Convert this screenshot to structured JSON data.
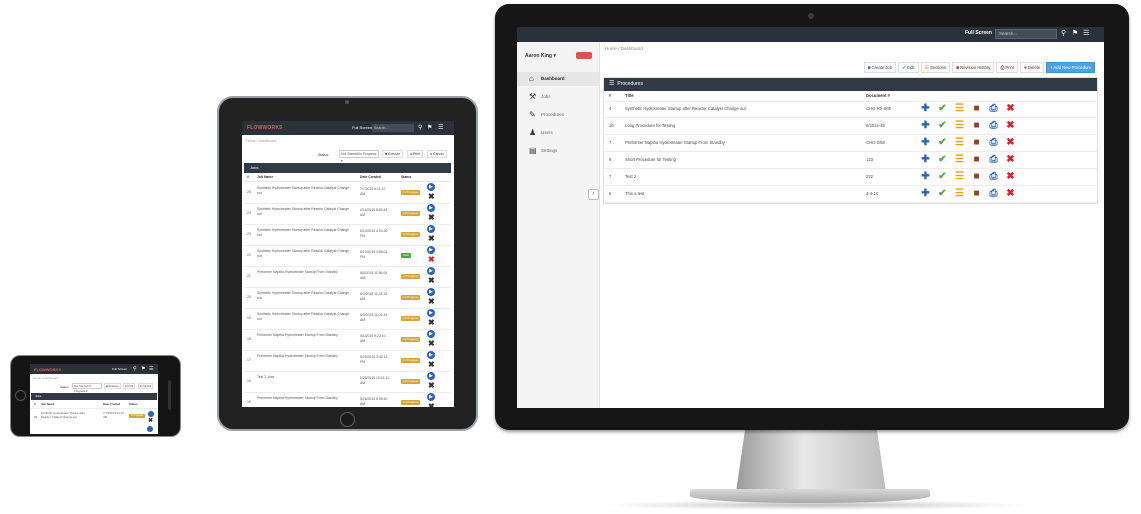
{
  "desktop": {
    "topbar": {
      "full_screen_label": "Full Screen",
      "search_placeholder": "Search...",
      "search_icon": "search-icon",
      "flag_icon": "flag-icon",
      "menu_icon": "menu-icon"
    },
    "sidebar": {
      "user_label": "Aaron King ▾",
      "items": [
        {
          "label": "Dashboard",
          "icon": "home-icon",
          "glyph": "⌂"
        },
        {
          "label": "Jobs",
          "icon": "wrench-icon",
          "glyph": "⚒"
        },
        {
          "label": "Procedures",
          "icon": "edit-icon",
          "glyph": "✎"
        },
        {
          "label": "Users",
          "icon": "user-icon",
          "glyph": "♟"
        },
        {
          "label": "Settings",
          "icon": "settings-icon",
          "glyph": "▤"
        }
      ],
      "collapse_glyph": "‹"
    },
    "breadcrumb": "Home  /  Dashboard",
    "toolbar": [
      {
        "label": "Create Job",
        "glyph": "■",
        "color": "#2a63b8"
      },
      {
        "label": "Edit",
        "glyph": "✔",
        "color": "#52a34a"
      },
      {
        "label": "Sections",
        "glyph": "☰",
        "color": "#f0a000"
      },
      {
        "label": "Revision History",
        "glyph": "■",
        "color": "#9b3b2a"
      },
      {
        "label": "Print",
        "glyph": "⎙",
        "color": "#333333"
      },
      {
        "label": "Delete",
        "glyph": "●",
        "color": "#d9232a"
      },
      {
        "label": "+ Add New Procedure",
        "glyph": "",
        "color": "#ffffff"
      }
    ],
    "panel_title": "Procedures",
    "columns": {
      "num": "#",
      "title": "Title",
      "doc": "Document #"
    },
    "rows": [
      {
        "num": "4",
        "title": "Synthetic Hydrotreater Startup after Reactor Catalyst Change out",
        "doc": "CHO-RX-005"
      },
      {
        "num": "10",
        "title": "Long Procedure for Testing",
        "doc": "9/2012-45"
      },
      {
        "num": "7",
        "title": "Preformer Naptha Hydrotreater Startup From Standby",
        "doc": "CHO-SN8"
      },
      {
        "num": "9",
        "title": "Short Procedure for Testing",
        "doc": "123"
      },
      {
        "num": "7",
        "title": "Test 2",
        "doc": "222"
      },
      {
        "num": "6",
        "title": "This a test",
        "doc": "4-4-14"
      }
    ],
    "row_actions": [
      {
        "icon": "add-icon",
        "glyph": "✚",
        "color": "#2a63b8"
      },
      {
        "icon": "check-icon",
        "glyph": "✔",
        "color": "#52a34a"
      },
      {
        "icon": "list-icon",
        "glyph": "☰",
        "color": "#f0a000"
      },
      {
        "icon": "folder-icon",
        "glyph": "■",
        "color": "#9b3b2a"
      },
      {
        "icon": "print-icon",
        "glyph": "⎙",
        "color": "#2a63b8"
      },
      {
        "icon": "delete-icon",
        "glyph": "✖",
        "color": "#d9232a"
      }
    ]
  },
  "tablet": {
    "logo": "FLOWWORKS",
    "full_screen_label": "Full Screen",
    "search_placeholder": "Search...",
    "breadcrumb": "Home  /  Dashboard",
    "status_label": "Status:",
    "status_select": "Not Started/In Progress ▾",
    "buttons": [
      "■ Execute",
      "● Print",
      "● Cancel"
    ],
    "panel_title": "Jobs",
    "columns": {
      "num": "#",
      "job": "Job Name",
      "date": "Date Created",
      "status": "Status"
    },
    "rows": [
      {
        "num": "25",
        "job": "Synthetic Hydrotreater Startup after Reactor Catalyst Change out",
        "date": "7/7/2015 9:11:10 AM",
        "status": "In Progress",
        "green": false
      },
      {
        "num": "24",
        "job": "Synthetic Hydrotreater Startup after Reactor Catalyst Change out",
        "date": "6/15/2015 8:59:44 AM",
        "status": "In Progress",
        "green": false
      },
      {
        "num": "23",
        "job": "Synthetic Hydrotreater Startup after Reactor Catalyst Change out",
        "date": "6/10/2015 4:04:30 PM",
        "status": "In Progress",
        "green": false
      },
      {
        "num": "22",
        "job": "Synthetic Hydrotreater Startup after Reactor Catalyst Change out",
        "date": "6/10/2015 3:58:01 PM",
        "status": "New",
        "green": true
      },
      {
        "num": "21",
        "job": "Preformer Naptha Hydrotreater Startup From Standby",
        "date": "6/5/2015 11:56:05 AM",
        "status": "In Progress",
        "green": false
      },
      {
        "num": "20",
        "job": "Synthetic Hydrotreater Startup after Reactor Catalyst Change out",
        "date": "6/3/2015 11:24:15 AM",
        "status": "In Progress",
        "green": false
      },
      {
        "num": "19",
        "job": "Synthetic Hydrotreater Startup after Reactor Catalyst Change out",
        "date": "6/3/2015 11:01:33 AM",
        "status": "In Progress",
        "green": false
      },
      {
        "num": "18",
        "job": "Preformer Naptha Hydrotreater Startup From Standby",
        "date": "6/1/2015 9:22:10 AM",
        "status": "In Progress",
        "green": false
      },
      {
        "num": "17",
        "job": "Preformer Naptha Hydrotreater Startup From Standby",
        "date": "5/29/2015 3:40:12 PM",
        "status": "In Progress",
        "green": false
      },
      {
        "num": "16",
        "job": "Test 2 Jobs",
        "date": "5/28/2015 10:41:11 AM",
        "status": "In Progress",
        "green": false
      },
      {
        "num": "15",
        "job": "Preformer Naptha Hydrotreater Startup From Standby",
        "date": "5/26/2015 8:05:40 AM",
        "status": "In Progress",
        "green": false
      }
    ]
  },
  "phone": {
    "logo": "FLOWWORKS",
    "full_screen_label": "Full Screen",
    "breadcrumb": "Home  /  Dashboard",
    "status_label": "Status:",
    "status_select": "Not Started/In Progress ▾",
    "buttons": [
      "■ Execute",
      "● Print",
      "● Cancel"
    ],
    "panel_title": "Jobs",
    "columns": {
      "num": "#",
      "job": "Job Name",
      "date": "Date Created",
      "status": "Status"
    },
    "row": {
      "num": "25",
      "job": "Synthetic Hydrotreater Startup after Reactor Catalyst Change out",
      "date": "7/7/2015 9:11:10 AM",
      "status": "In Progress"
    }
  }
}
